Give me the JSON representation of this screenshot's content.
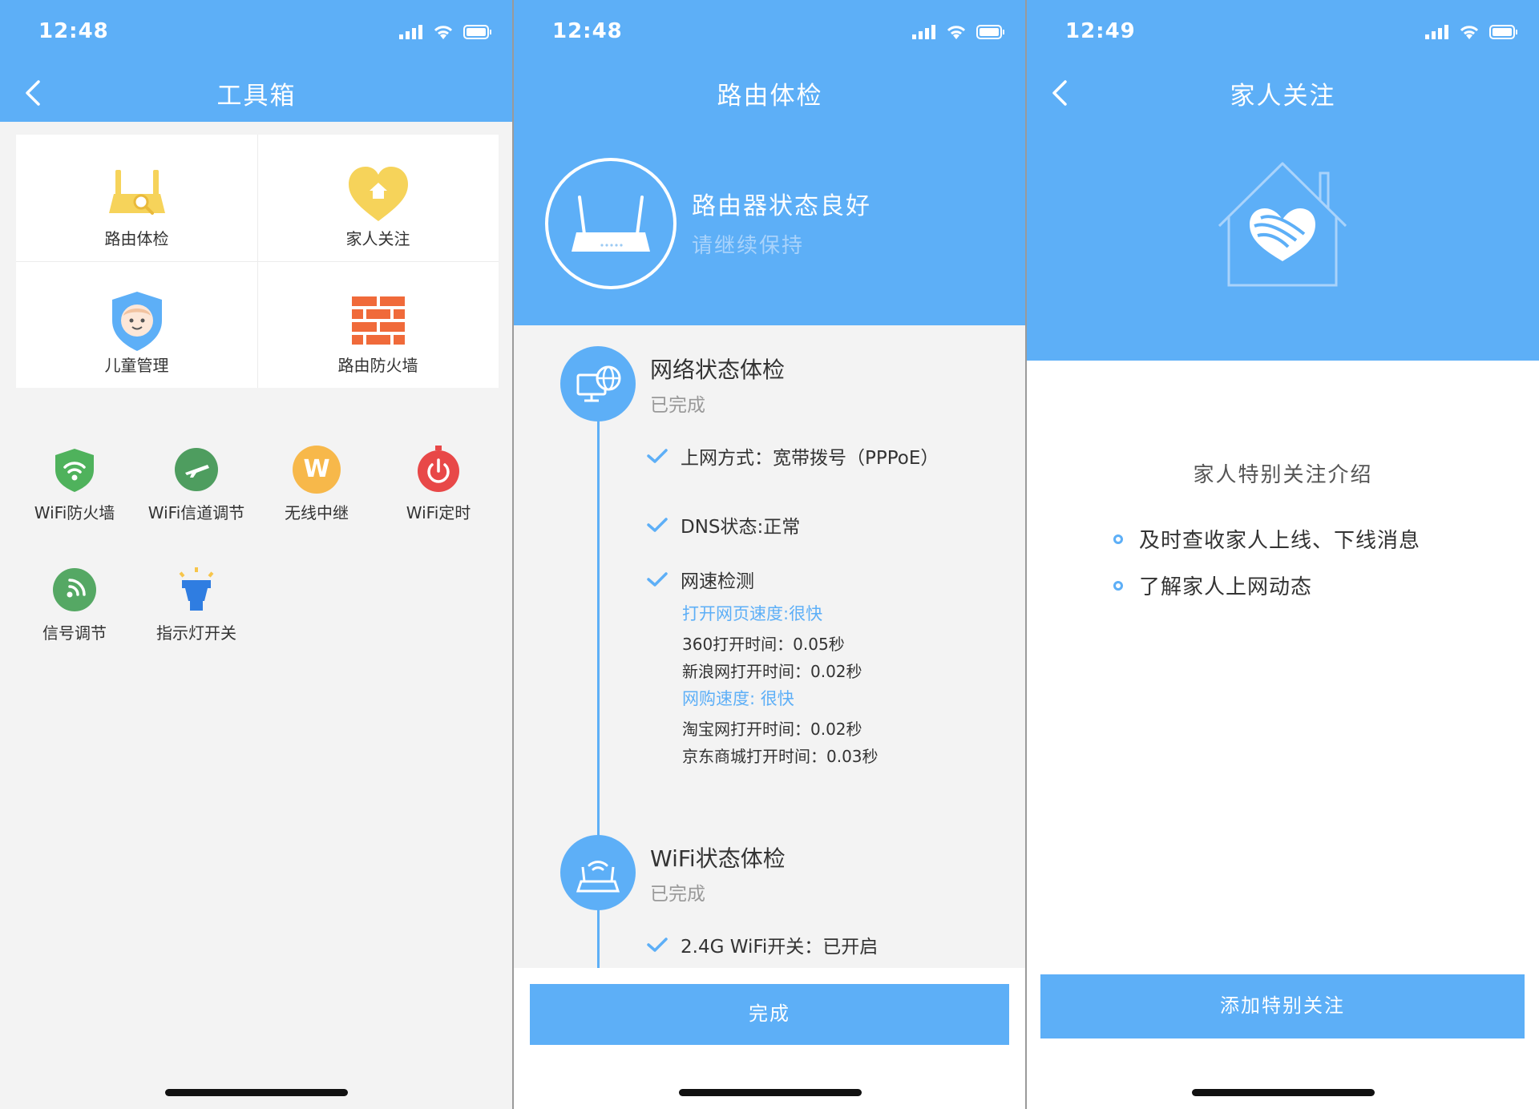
{
  "screens": {
    "toolbox": {
      "time": "12:48",
      "title": "工具箱",
      "grid": [
        {
          "label": "路由体检",
          "icon": "router-check-icon"
        },
        {
          "label": "家人关注",
          "icon": "heart-home-icon"
        },
        {
          "label": "儿童管理",
          "icon": "child-shield-icon"
        },
        {
          "label": "路由防火墙",
          "icon": "brick-wall-icon"
        }
      ],
      "tools": [
        {
          "label": "WiFi防火墙",
          "icon": "wifi-shield-icon"
        },
        {
          "label": "WiFi信道调节",
          "icon": "plane-icon"
        },
        {
          "label": "无线中继",
          "icon": "w-badge-icon",
          "badge": "W"
        },
        {
          "label": "WiFi定时",
          "icon": "power-timer-icon"
        },
        {
          "label": "信号调节",
          "icon": "signal-icon"
        },
        {
          "label": "指示灯开关",
          "icon": "lamp-icon"
        }
      ]
    },
    "checkup": {
      "time": "12:48",
      "title": "路由体检",
      "status": "路由器状态良好",
      "status_sub": "请继续保持",
      "network": {
        "title": "网络状态体检",
        "state": "已完成",
        "items": [
          "上网方式：宽带拨号（PPPoE）",
          "DNS状态:正常",
          "网速检测"
        ],
        "details": [
          {
            "text": "打开网页速度:很快",
            "highlight": true
          },
          {
            "text": "360打开时间：0.05秒",
            "highlight": false
          },
          {
            "text": "新浪网打开时间：0.02秒",
            "highlight": false
          },
          {
            "text": "网购速度: 很快",
            "highlight": true
          },
          {
            "text": "淘宝网打开时间：0.02秒",
            "highlight": false
          },
          {
            "text": "京东商城打开时间：0.03秒",
            "highlight": false
          }
        ]
      },
      "wifi": {
        "title": "WiFi状态体检",
        "state": "已完成",
        "items": [
          "2.4G WiFi开关：已开启"
        ]
      },
      "done_label": "完成"
    },
    "family": {
      "time": "12:49",
      "title": "家人关注",
      "intro_title": "家人特别关注介绍",
      "bullets": [
        "及时查收家人上线、下线消息",
        "了解家人上网动态"
      ],
      "add_label": "添加特别关注"
    }
  },
  "colors": {
    "primary": "#5daff7",
    "background": "#f3f3f3",
    "yellow": "#f6d35a",
    "green": "#4fb25c",
    "orange_brick": "#f06a3a",
    "red": "#e84848",
    "gold": "#f7b84a"
  }
}
